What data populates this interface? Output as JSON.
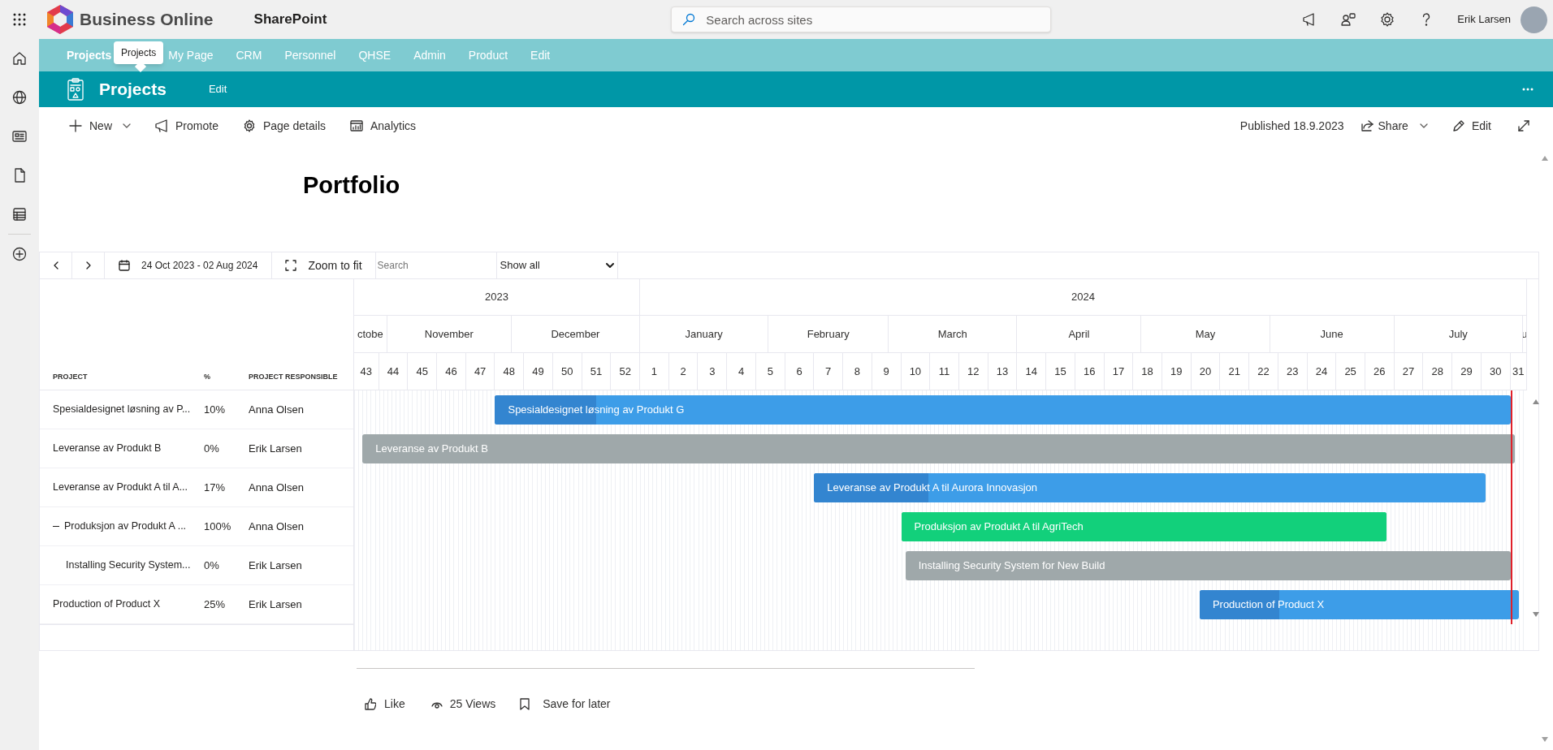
{
  "top_bar": {
    "brand": "Business Online",
    "app": "SharePoint",
    "search": {
      "placeholder": "Search across sites"
    },
    "user": "Erik Larsen"
  },
  "hub_nav": {
    "items": [
      {
        "label": "Projects",
        "selected": true
      },
      {
        "label": "My Page",
        "selected": false
      },
      {
        "label": "CRM",
        "selected": false
      },
      {
        "label": "Personnel",
        "selected": false
      },
      {
        "label": "QHSE",
        "selected": false
      },
      {
        "label": "Admin",
        "selected": false
      },
      {
        "label": "Product",
        "selected": false
      },
      {
        "label": "Edit",
        "selected": false
      }
    ],
    "tooltip": "Projects"
  },
  "site_header": {
    "title": "Projects",
    "edit": "Edit"
  },
  "command_bar": {
    "items": [
      {
        "kind": "new",
        "label": "New"
      },
      {
        "kind": "promote",
        "label": "Promote"
      },
      {
        "kind": "details",
        "label": "Page details"
      },
      {
        "kind": "analytics",
        "label": "Analytics"
      }
    ],
    "published": "Published 18.9.2023",
    "share": "Share",
    "edit": "Edit"
  },
  "page_title": "Portfolio",
  "gantt": {
    "toolbar": {
      "date_range": "24 Oct 2023 - 02 Aug 2024",
      "zoom": "Zoom to fit",
      "search": {
        "placeholder": "Search"
      },
      "filter": "Show all"
    },
    "columns": [
      "PROJECT",
      "%",
      "PROJECT RESPONSIBLE"
    ],
    "timeline": {
      "years": [
        "2023",
        "2024"
      ],
      "months": [
        "ctobe",
        "November",
        "December",
        "January",
        "February",
        "March",
        "April",
        "May",
        "June",
        "July",
        "u"
      ],
      "weeks": [
        "43",
        "44",
        "45",
        "46",
        "47",
        "48",
        "49",
        "50",
        "51",
        "52",
        "1",
        "2",
        "3",
        "4",
        "5",
        "6",
        "7",
        "8",
        "9",
        "10",
        "11",
        "12",
        "13",
        "14",
        "15",
        "16",
        "17",
        "18",
        "19",
        "20",
        "21",
        "22",
        "23",
        "24",
        "25",
        "26",
        "27",
        "28",
        "29",
        "30",
        "31"
      ]
    },
    "rows": [
      {
        "project": "Spesialdesignet løsning av P...",
        "percent": "10%",
        "responsible": "Anna Olsen",
        "bar": {
          "label": "Spesialdesignet løsning av Produkt G",
          "level": 0.1
        }
      },
      {
        "project": "Leveranse av Produkt B",
        "percent": "0%",
        "responsible": "Erik Larsen",
        "bar": {
          "label": "Leveranse av Produkt B",
          "level": 0
        }
      },
      {
        "project": "Leveranse av Produkt A til A...",
        "percent": "17%",
        "responsible": "Anna Olsen",
        "bar": {
          "label": "Leveranse av Produkt A til Aurora Innovasjon",
          "level": 0.17
        }
      },
      {
        "project": "Produksjon av Produkt A ...",
        "percent": "100%",
        "responsible": "Anna Olsen",
        "expanded": true,
        "bar": {
          "label": "Produksjon av Produkt A til AgriTech",
          "level": 1
        },
        "children": [
          {
            "project": "Installing Security System...",
            "percent": "0%",
            "responsible": "Erik Larsen",
            "bar": {
              "label": "Installing Security System for New Build",
              "level": 0
            }
          }
        ]
      },
      {
        "project": "Production of Product X",
        "percent": "25%",
        "responsible": "Erik Larsen",
        "bar": {
          "label": "Production of Product X",
          "level": 0.25
        }
      }
    ]
  },
  "footer": {
    "like": "Like",
    "views": "25 Views",
    "save": "Save for later"
  }
}
